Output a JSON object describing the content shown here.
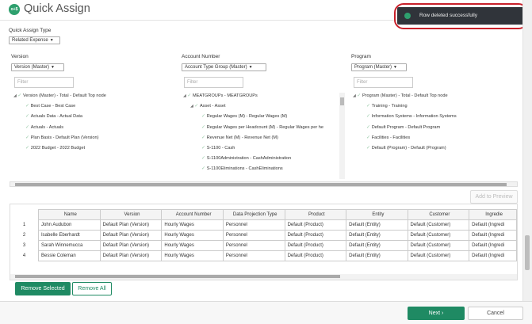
{
  "header": {
    "logo_text": "o+$",
    "title": "Quick Assign"
  },
  "toast": {
    "message": "Row deleted successfully"
  },
  "quick_assign_type": {
    "label": "Quick Assign Type",
    "value": "Related Expense"
  },
  "version_panel": {
    "label": "Version",
    "select_value": "Version (Master)",
    "filter_placeholder": "Filter",
    "items": [
      "Version (Master) - Total - Default Top node",
      "Best Case - Best Case",
      "Actuals Data - Actual Data",
      "Actuals - Actuals",
      "Plan Basis - Default Plan (Version)",
      "2022 Budget - 2022 Budget"
    ]
  },
  "account_panel": {
    "label": "Account Number",
    "select_value": "Account Type Group (Master)",
    "filter_placeholder": "Filter",
    "items": [
      "MEATGROUPs - MEATGROUPs",
      "Asset - Asset",
      "Regular Wages (M) - Regular Wages (M)",
      "Regular Wages per Headcount (M) - Regular Wages per he",
      "Revenue Net (M) - Revenue Net (M)",
      "S-1100 - Cash",
      "S-1100Administration - CashAdministration",
      "S-1100Eliminations - CashEliminations"
    ]
  },
  "program_panel": {
    "label": "Program",
    "select_value": "Program (Master)",
    "filter_placeholder": "Filter",
    "items": [
      "Program (Master) - Total - Default Top node",
      "Training - Training",
      "Information Systems - Information Systems",
      "Default Program - Default Program",
      "Facilities - Facilities",
      "Default (Program) - Default (Program)"
    ]
  },
  "add_to_preview_label": "Add to Preview",
  "grid": {
    "columns": [
      "Name",
      "Version",
      "Account Number",
      "Data Projection Type",
      "Product",
      "Entity",
      "Customer",
      "Ingredie"
    ],
    "rows": [
      {
        "num": "1",
        "cells": [
          "John Audubon",
          "Default Plan (Version)",
          "Hourly Wages",
          "Personnel",
          "Default (Product)",
          "Default (Entity)",
          "Default (Customer)",
          "Default (Ingredi"
        ]
      },
      {
        "num": "2",
        "cells": [
          "Isabelle Eberhardt",
          "Default Plan (Version)",
          "Hourly Wages",
          "Personnel",
          "Default (Product)",
          "Default (Entity)",
          "Default (Customer)",
          "Default (Ingredi"
        ]
      },
      {
        "num": "3",
        "cells": [
          "Sarah Winnemucca",
          "Default Plan (Version)",
          "Hourly Wages",
          "Personnel",
          "Default (Product)",
          "Default (Entity)",
          "Default (Customer)",
          "Default (Ingredi"
        ]
      },
      {
        "num": "4",
        "cells": [
          "Bessie Coleman",
          "Default Plan (Version)",
          "Hourly Wages",
          "Personnel",
          "Default (Product)",
          "Default (Entity)",
          "Default (Customer)",
          "Default (Ingredi"
        ]
      }
    ]
  },
  "remove_selected_label": "Remove Selected",
  "remove_all_label": "Remove All",
  "next_label": "Next",
  "cancel_label": "Cancel",
  "colors": {
    "accent": "#1f8a63",
    "toast_bg": "#30343a",
    "highlight_ring": "#c8202a"
  }
}
